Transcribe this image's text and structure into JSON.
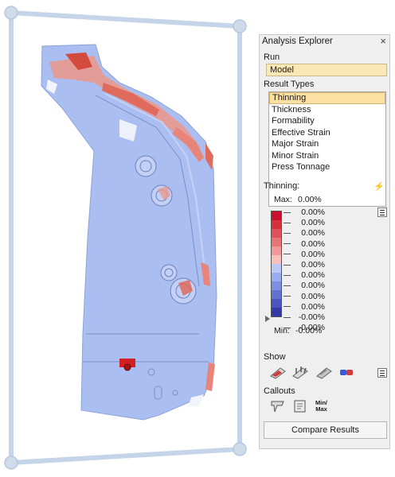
{
  "panel": {
    "title": "Analysis Explorer",
    "close_glyph": "×",
    "run_label": "Run",
    "run_value": "Model",
    "result_types_label": "Result Types",
    "result_types": [
      "Thinning",
      "Thickness",
      "Formability",
      "Effective Strain",
      "Major Strain",
      "Minor Strain",
      "Press Tonnage"
    ],
    "selected_result_type": "Thinning",
    "thinning_label": "Thinning:",
    "legend": {
      "max_label": "Max:",
      "max_value": "0.00%",
      "min_label": "Min:",
      "min_value": "-0.00%",
      "values": [
        "0.00%",
        "0.00%",
        "0.00%",
        "0.00%",
        "0.00%",
        "0.00%",
        "0.00%",
        "0.00%",
        "0.00%",
        "0.00%",
        "-0.00%",
        "-0.00%"
      ],
      "colors": [
        "#c8102e",
        "#d6303d",
        "#e0505a",
        "#e87476",
        "#f0989a",
        "#f7c0bd",
        "#b9c8f5",
        "#98adef",
        "#7b90e2",
        "#6173d0",
        "#4b55bf",
        "#3539a8"
      ]
    },
    "show_label": "Show",
    "show_icons": [
      "contour-icon",
      "vector-icon",
      "deformed-shape-icon",
      "color-blend-icon"
    ],
    "callouts_label": "Callouts",
    "callout_icons": [
      "callout-pin-icon",
      "callout-note-icon"
    ],
    "min_max_label": "Min/\nMax",
    "compare_button": "Compare Results"
  }
}
